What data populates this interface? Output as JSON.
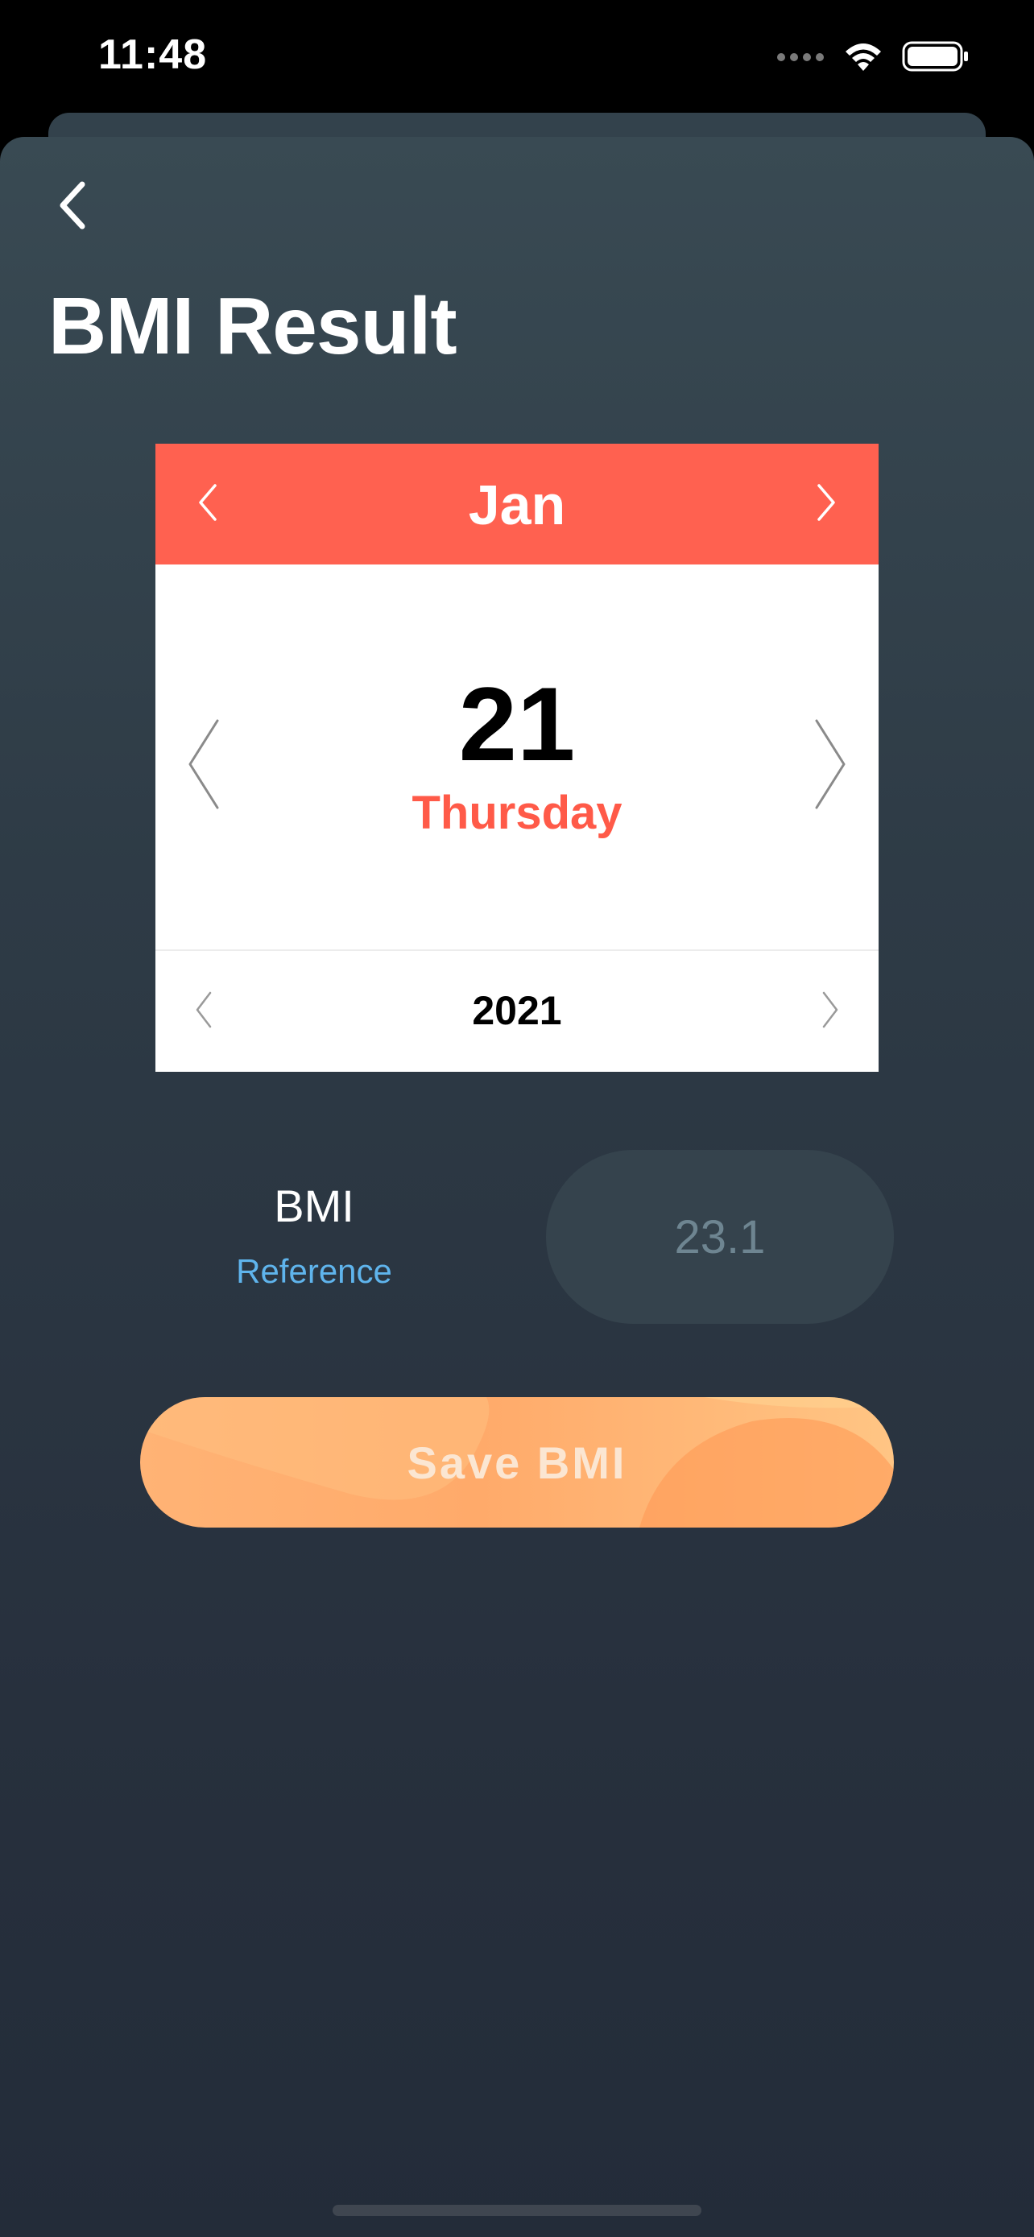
{
  "status_bar": {
    "time": "11:48",
    "icons": [
      "signal-icon",
      "wifi-icon",
      "battery-icon"
    ]
  },
  "header": {
    "back_icon": "chevron-left-icon",
    "title": "BMI Result"
  },
  "calendar": {
    "month": "Jan",
    "day": "21",
    "weekday": "Thursday",
    "year": "2021",
    "colors": {
      "header": "#ff6150",
      "weekday": "#ff5a48"
    }
  },
  "bmi": {
    "label": "BMI",
    "reference_link": "Reference",
    "value": "23.1"
  },
  "actions": {
    "save_label": "Save BMI"
  },
  "colors": {
    "accent": "#ffa86a",
    "link": "#5fb4ec",
    "background": "#2b3743"
  }
}
